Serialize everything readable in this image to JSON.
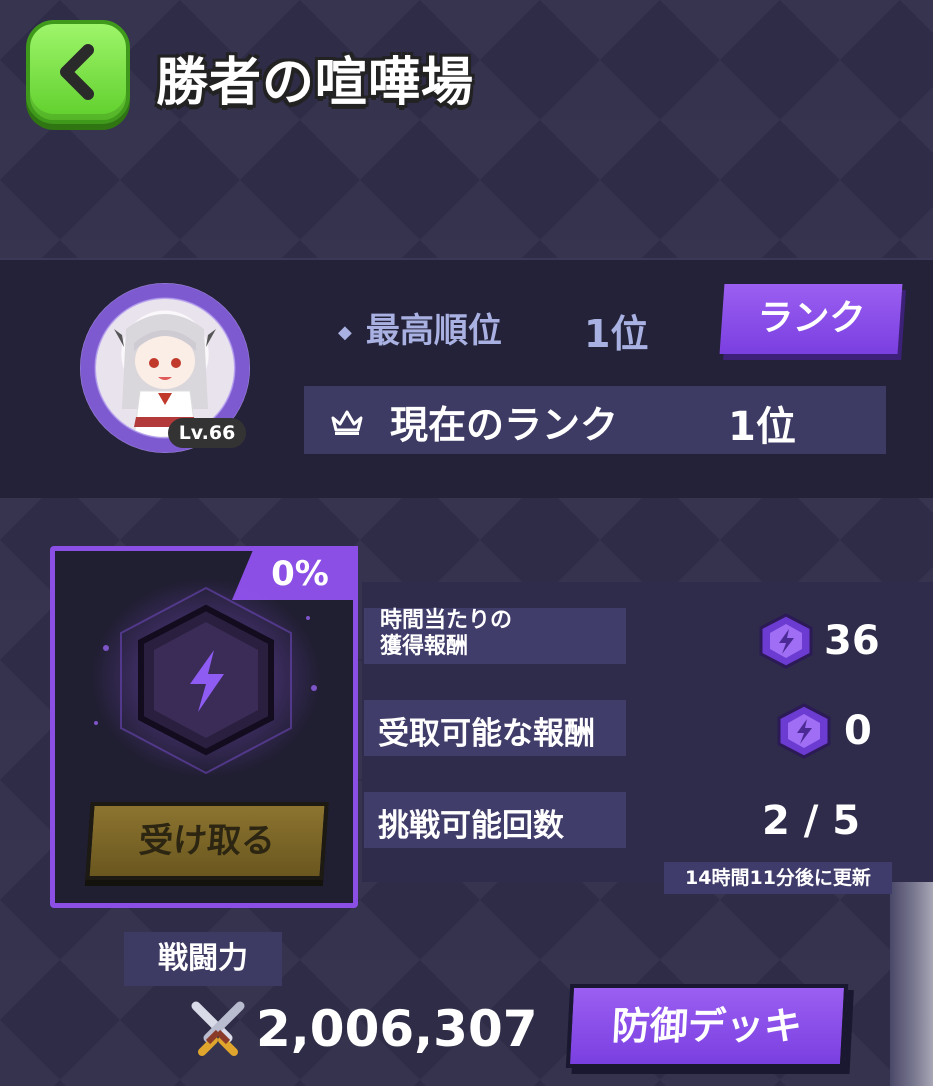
{
  "header": {
    "title": "勝者の喧嘩場",
    "back_icon": "chevron-left-icon"
  },
  "profile": {
    "level": "Lv.66",
    "best_rank_label": "最高順位",
    "best_rank_value": "1位",
    "rank_button": "ランク",
    "current_rank_label": "現在のランク",
    "current_rank_value": "1位"
  },
  "reward": {
    "percent": "0%",
    "claim_button": "受け取る",
    "hourly_label_line1": "時間当たりの",
    "hourly_label_line2": "獲得報酬",
    "hourly_value": "36",
    "claimable_label": "受取可能な報酬",
    "claimable_value": "0",
    "challenges_label": "挑戦可能回数",
    "challenges_value": "2 / 5",
    "refresh_note": "14時間11分後に更新"
  },
  "power": {
    "label": "戦闘力",
    "value": "2,006,307",
    "defense_button": "防御デッキ"
  },
  "colors": {
    "background": "#2e2c47",
    "accent_purple": "#8b4fe6",
    "back_green": "#7ad94a",
    "claim_gold": "#7d6828"
  }
}
